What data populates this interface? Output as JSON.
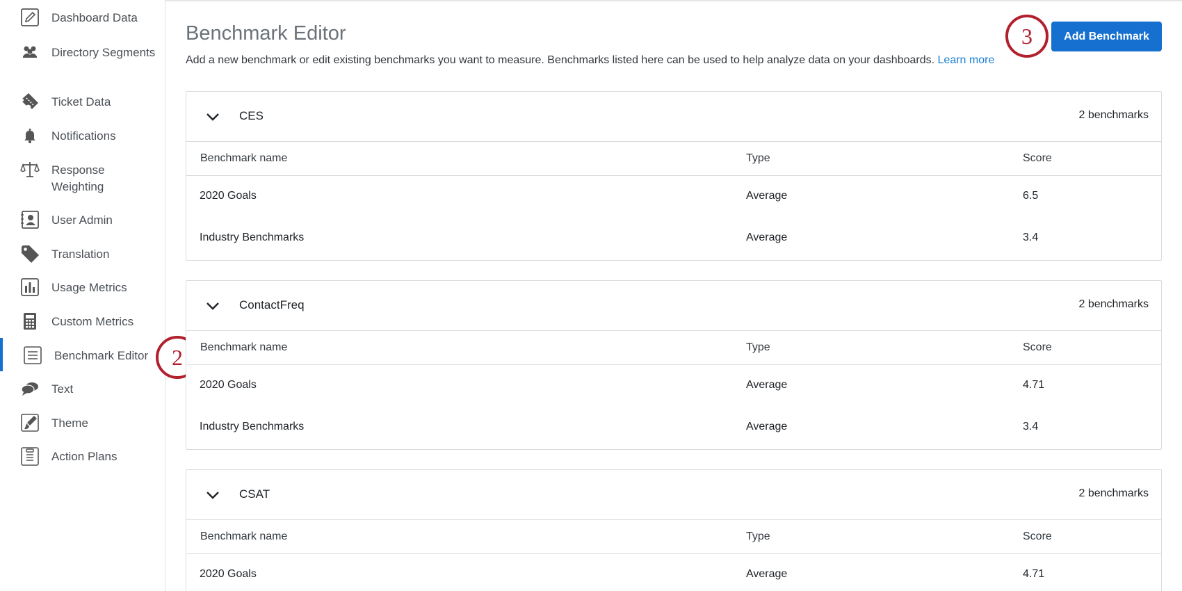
{
  "sidebar": {
    "items": [
      {
        "label": "Dashboard Data",
        "icon": "pencil-icon"
      },
      {
        "label": "Directory Segments",
        "icon": "people-icon"
      },
      {
        "label": "Ticket Data",
        "icon": "ticket-icon"
      },
      {
        "label": "Notifications",
        "icon": "bell-icon"
      },
      {
        "label": "Response Weighting",
        "icon": "scale-icon"
      },
      {
        "label": "User Admin",
        "icon": "user-card-icon"
      },
      {
        "label": "Translation",
        "icon": "tag-icon"
      },
      {
        "label": "Usage Metrics",
        "icon": "bar-chart-icon"
      },
      {
        "label": "Custom Metrics",
        "icon": "calculator-icon"
      },
      {
        "label": "Benchmark Editor",
        "icon": "list-icon",
        "active": true
      },
      {
        "label": "Text",
        "icon": "chat-bubbles-icon"
      },
      {
        "label": "Theme",
        "icon": "paint-brush-icon"
      },
      {
        "label": "Action Plans",
        "icon": "clipboard-icon"
      }
    ]
  },
  "callouts": {
    "step2": "2",
    "step3": "3"
  },
  "header": {
    "title": "Benchmark Editor",
    "description": "Add a new benchmark or edit existing benchmarks you want to measure. Benchmarks listed here can be used to help analyze data on your dashboards. ",
    "learn_more": "Learn more",
    "add_button": "Add Benchmark"
  },
  "columns": {
    "name": "Benchmark name",
    "type": "Type",
    "score": "Score"
  },
  "panels": [
    {
      "name": "CES",
      "count": "2 benchmarks",
      "rows": [
        {
          "name": "2020 Goals",
          "type": "Average",
          "score": "6.5"
        },
        {
          "name": "Industry Benchmarks",
          "type": "Average",
          "score": "3.4"
        }
      ]
    },
    {
      "name": "ContactFreq",
      "count": "2 benchmarks",
      "rows": [
        {
          "name": "2020 Goals",
          "type": "Average",
          "score": "4.71"
        },
        {
          "name": "Industry Benchmarks",
          "type": "Average",
          "score": "3.4"
        }
      ]
    },
    {
      "name": "CSAT",
      "count": "2 benchmarks",
      "rows": [
        {
          "name": "2020 Goals",
          "type": "Average",
          "score": "4.71"
        }
      ]
    }
  ],
  "colors": {
    "accent": "#1570d0",
    "callout": "#b21f2d",
    "link": "#1a7fd4"
  }
}
